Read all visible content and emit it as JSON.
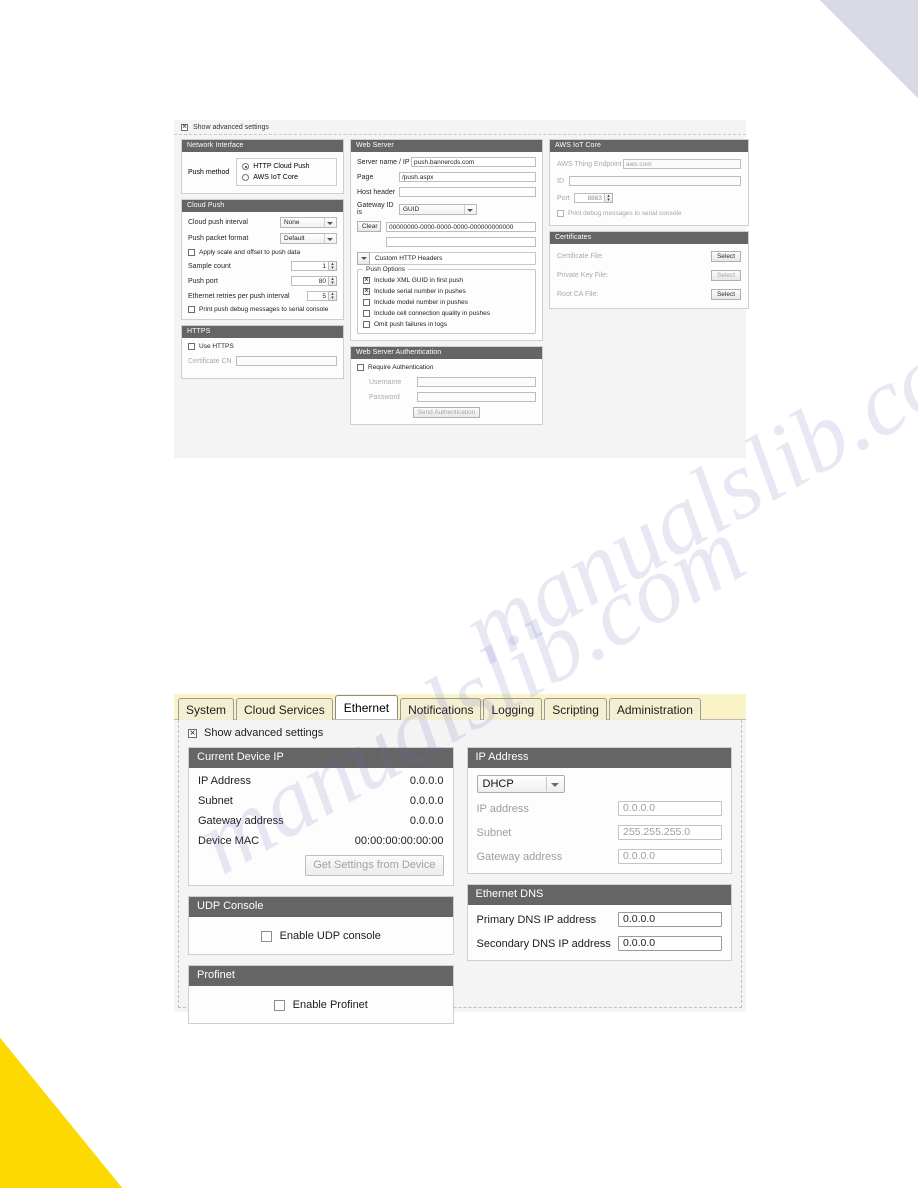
{
  "page": {
    "watermark_text": "manualslib.com"
  },
  "cloud_screenshot": {
    "advanced": {
      "label": "Show advanced settings",
      "checked": true
    },
    "network_interface": {
      "title": "Network Interface",
      "push_method_label": "Push method",
      "options": [
        {
          "label": "HTTP Cloud Push",
          "selected": true
        },
        {
          "label": "AWS IoT Core",
          "selected": false
        }
      ]
    },
    "cloud_push": {
      "title": "Cloud Push",
      "interval_label": "Cloud push interval",
      "interval_value": "None",
      "packet_format_label": "Push packet format",
      "packet_format_value": "Default",
      "apply_scale_label": "Apply scale and offset to push data",
      "sample_count_label": "Sample count",
      "sample_count_value": "1",
      "push_port_label": "Push port",
      "push_port_value": "80",
      "retries_label": "Ethernet retries per push interval",
      "retries_value": "5",
      "debug_label": "Print push debug messages to serial console"
    },
    "https": {
      "title": "HTTPS",
      "use_https_label": "Use HTTPS",
      "certificate_cn_label": "Certificate CN",
      "certificate_cn_value": ""
    },
    "web_server": {
      "title": "Web Server",
      "server_name_label": "Server name / IP",
      "server_name_value": "push.bannercds.com",
      "page_label": "Page",
      "page_value": "/push.aspx",
      "host_header_label": "Host header",
      "host_header_value": "",
      "gateway_id_label": "Gateway ID is",
      "gateway_id_value": "GUID",
      "clear_button": "Clear",
      "guid_value": "00000000-0000-0000-0000-000000000000",
      "extra_value": "",
      "custom_headers_label": "Custom HTTP Headers",
      "push_options_title": "Push Options",
      "push_options": [
        {
          "label": "Include XML GUID in first push",
          "checked": true
        },
        {
          "label": "Include serial number in pushes",
          "checked": true
        },
        {
          "label": "Include model number in pushes",
          "checked": false
        },
        {
          "label": "Include cell connection quality in pushes",
          "checked": false
        },
        {
          "label": "Omit push failures in logs",
          "checked": false
        }
      ]
    },
    "web_server_auth": {
      "title": "Web Server Authentication",
      "require_auth_label": "Require Authentication",
      "username_label": "Username",
      "username_value": "",
      "password_label": "Password",
      "password_value": "",
      "send_button": "Send Authentication"
    },
    "aws_iot_core": {
      "title": "AWS IoT Core",
      "endpoint_label": "AWS Thing Endpoint",
      "endpoint_value": "aws.com",
      "id_label": "ID",
      "id_value": "",
      "port_label": "Port",
      "port_value": "8883",
      "debug_label": "Print debug messages to serial console"
    },
    "certificates": {
      "title": "Certificates",
      "rows": [
        {
          "label": "Certificate File:",
          "button": "Select"
        },
        {
          "label": "Private Key File:",
          "button": "Select"
        },
        {
          "label": "Root CA File:",
          "button": "Select"
        }
      ]
    }
  },
  "ethernet_screenshot": {
    "tabs": [
      {
        "label": "System",
        "active": false
      },
      {
        "label": "Cloud Services",
        "active": false
      },
      {
        "label": "Ethernet",
        "active": true
      },
      {
        "label": "Notifications",
        "active": false
      },
      {
        "label": "Logging",
        "active": false
      },
      {
        "label": "Scripting",
        "active": false
      },
      {
        "label": "Administration",
        "active": false
      }
    ],
    "advanced": {
      "label": "Show advanced settings",
      "checked": true
    },
    "current_device_ip": {
      "title": "Current Device IP",
      "rows": [
        {
          "label": "IP Address",
          "value": "0.0.0.0"
        },
        {
          "label": "Subnet",
          "value": "0.0.0.0"
        },
        {
          "label": "Gateway address",
          "value": "0.0.0.0"
        },
        {
          "label": "Device MAC",
          "value": "00:00:00:00:00:00"
        }
      ],
      "get_settings_button": "Get Settings from Device"
    },
    "udp_console": {
      "title": "UDP Console",
      "enable_label": "Enable UDP console",
      "checked": false
    },
    "profinet": {
      "title": "Profinet",
      "enable_label": "Enable Profinet",
      "checked": false
    },
    "ip_address": {
      "title": "IP Address",
      "mode_value": "DHCP",
      "rows": [
        {
          "label": "IP address",
          "value": "0.0.0.0"
        },
        {
          "label": "Subnet",
          "value": "255.255.255.0"
        },
        {
          "label": "Gateway address",
          "value": "0.0.0.0"
        }
      ]
    },
    "ethernet_dns": {
      "title": "Ethernet DNS",
      "rows": [
        {
          "label": "Primary DNS IP address",
          "value": "0.0.0.0"
        },
        {
          "label": "Secondary DNS IP address",
          "value": "0.0.0.0"
        }
      ]
    }
  }
}
